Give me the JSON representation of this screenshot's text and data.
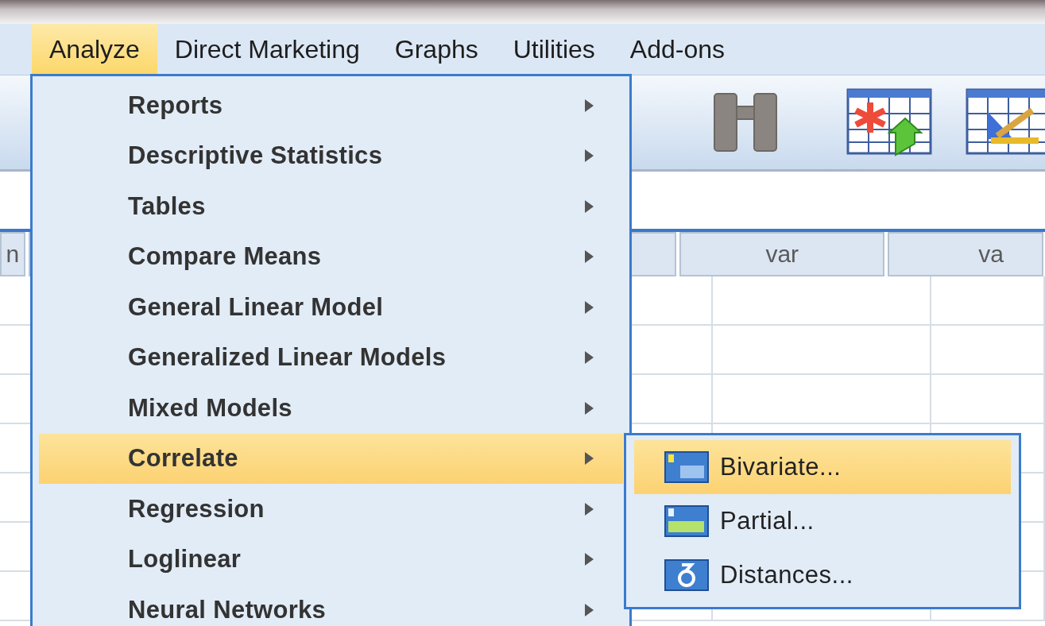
{
  "menubar": [
    {
      "label": "Analyze",
      "selected": true
    },
    {
      "label": "Direct Marketing",
      "selected": false
    },
    {
      "label": "Graphs",
      "selected": false
    },
    {
      "label": "Utilities",
      "selected": false
    },
    {
      "label": "Add-ons",
      "selected": false
    }
  ],
  "grid": {
    "columns": [
      "n",
      "var",
      "va"
    ]
  },
  "menu": {
    "items": [
      {
        "label": "Reports",
        "selected": false
      },
      {
        "label": "Descriptive Statistics",
        "selected": false
      },
      {
        "label": "Tables",
        "selected": false
      },
      {
        "label": "Compare Means",
        "selected": false
      },
      {
        "label": "General Linear Model",
        "selected": false
      },
      {
        "label": "Generalized Linear Models",
        "selected": false
      },
      {
        "label": "Mixed Models",
        "selected": false
      },
      {
        "label": "Correlate",
        "selected": true
      },
      {
        "label": "Regression",
        "selected": false
      },
      {
        "label": "Loglinear",
        "selected": false
      },
      {
        "label": "Neural Networks",
        "selected": false
      }
    ]
  },
  "submenu": {
    "items": [
      {
        "label": "Bivariate...",
        "selected": true,
        "kind": "bivariate"
      },
      {
        "label": "Partial...",
        "selected": false,
        "kind": "partial"
      },
      {
        "label": "Distances...",
        "selected": false,
        "kind": "distances"
      }
    ]
  }
}
